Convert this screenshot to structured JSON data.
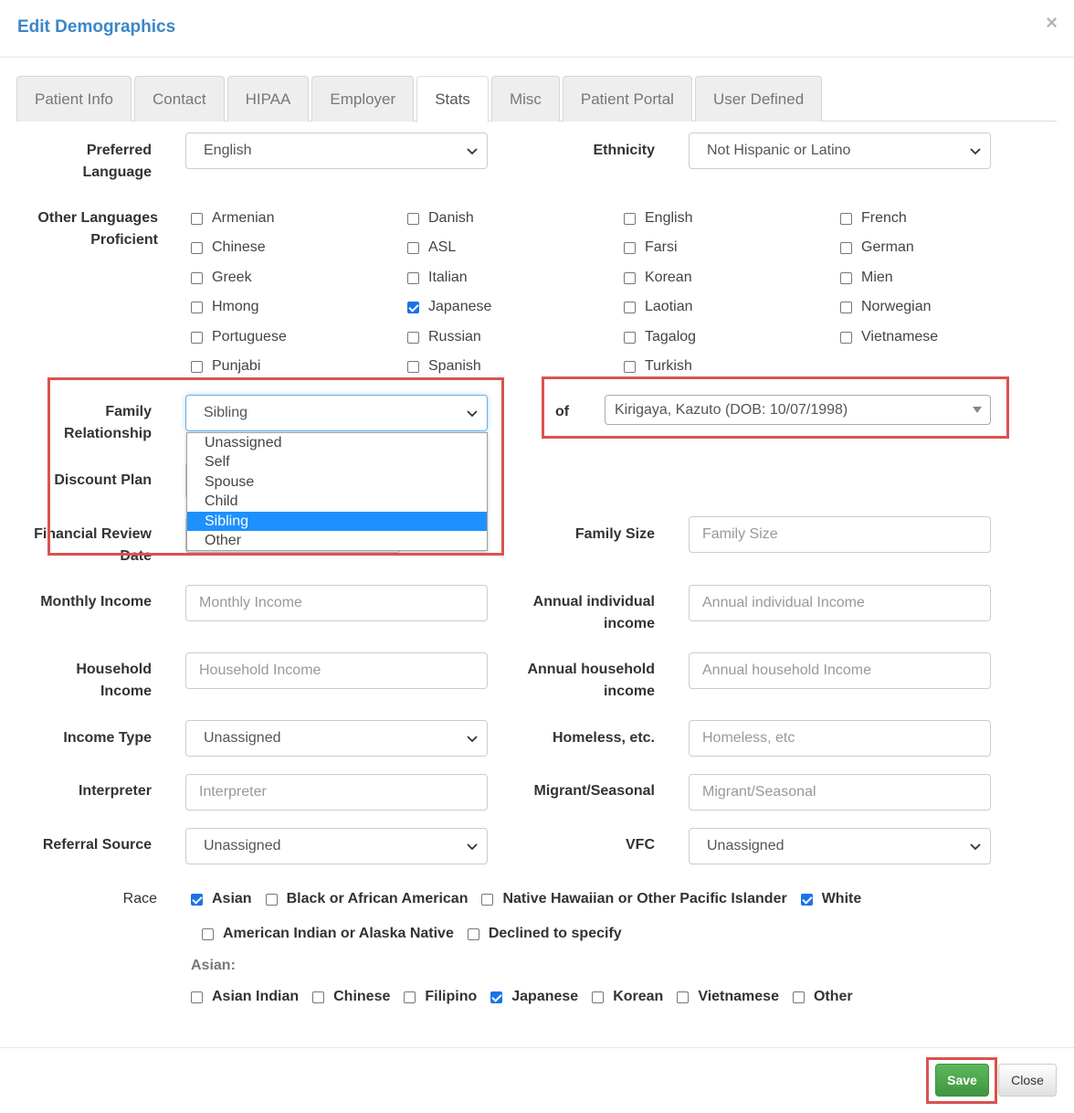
{
  "modal": {
    "title": "Edit Demographics",
    "close_icon": "close-x-icon"
  },
  "tabs": [
    {
      "label": "Patient Info",
      "active": false
    },
    {
      "label": "Contact",
      "active": false
    },
    {
      "label": "HIPAA",
      "active": false
    },
    {
      "label": "Employer",
      "active": false
    },
    {
      "label": "Stats",
      "active": true
    },
    {
      "label": "Misc",
      "active": false
    },
    {
      "label": "Patient Portal",
      "active": false
    },
    {
      "label": "User Defined",
      "active": false
    }
  ],
  "preferred_language": {
    "label_line1": "Preferred",
    "label_line2": "Language",
    "value": "English"
  },
  "ethnicity": {
    "label": "Ethnicity",
    "value": "Not Hispanic or Latino"
  },
  "other_languages": {
    "label_line1": "Other Languages",
    "label_line2": "Proficient",
    "columns": [
      [
        {
          "label": "Armenian",
          "checked": false
        },
        {
          "label": "Chinese",
          "checked": false
        },
        {
          "label": "Greek",
          "checked": false
        },
        {
          "label": "Hmong",
          "checked": false
        },
        {
          "label": "Portuguese",
          "checked": false
        },
        {
          "label": "Punjabi",
          "checked": false
        }
      ],
      [
        {
          "label": "Danish",
          "checked": false
        },
        {
          "label": "ASL",
          "checked": false
        },
        {
          "label": "Italian",
          "checked": false
        },
        {
          "label": "Japanese",
          "checked": true
        },
        {
          "label": "Russian",
          "checked": false
        },
        {
          "label": "Spanish",
          "checked": false
        }
      ],
      [
        {
          "label": "English",
          "checked": false
        },
        {
          "label": "Farsi",
          "checked": false
        },
        {
          "label": "Korean",
          "checked": false
        },
        {
          "label": "Laotian",
          "checked": false
        },
        {
          "label": "Tagalog",
          "checked": false
        },
        {
          "label": "Turkish",
          "checked": false
        }
      ],
      [
        {
          "label": "French",
          "checked": false
        },
        {
          "label": "German",
          "checked": false
        },
        {
          "label": "Mien",
          "checked": false
        },
        {
          "label": "Norwegian",
          "checked": false
        },
        {
          "label": "Vietnamese",
          "checked": false
        }
      ]
    ]
  },
  "family_relationship": {
    "label_line1": "Family",
    "label_line2": "Relationship",
    "value": "Sibling",
    "options": [
      "Unassigned",
      "Self",
      "Spouse",
      "Child",
      "Sibling",
      "Other"
    ],
    "selected_index": 4
  },
  "of": {
    "label": "of",
    "value": "Kirigaya, Kazuto (DOB: 10/07/1998)"
  },
  "discount_plan": {
    "label": "Discount Plan"
  },
  "financial_review_date": {
    "label_line1": "Financial Review",
    "label_line2": "Date"
  },
  "family_size": {
    "label": "Family Size",
    "placeholder": "Family Size"
  },
  "monthly_income": {
    "label": "Monthly Income",
    "placeholder": "Monthly Income"
  },
  "annual_individual_income": {
    "label_line1": "Annual individual",
    "label_line2": "income",
    "placeholder": "Annual individual Income"
  },
  "household_income": {
    "label_line1": "Household",
    "label_line2": "Income",
    "placeholder": "Household Income"
  },
  "annual_household_income": {
    "label_line1": "Annual household",
    "label_line2": "income",
    "placeholder": "Annual household Income"
  },
  "income_type": {
    "label": "Income Type",
    "value": "Unassigned"
  },
  "homeless": {
    "label": "Homeless, etc.",
    "placeholder": "Homeless, etc"
  },
  "interpreter": {
    "label": "Interpreter",
    "placeholder": "Interpreter"
  },
  "migrant_seasonal": {
    "label": "Migrant/Seasonal",
    "placeholder": "Migrant/Seasonal"
  },
  "referral_source": {
    "label": "Referral Source",
    "value": "Unassigned"
  },
  "vfc": {
    "label": "VFC",
    "value": "Unassigned"
  },
  "race": {
    "label": "Race",
    "row1": [
      {
        "label": "Asian",
        "checked": true
      },
      {
        "label": "Black or African American",
        "checked": false
      },
      {
        "label": "Native Hawaiian or Other Pacific Islander",
        "checked": false
      },
      {
        "label": "White",
        "checked": true
      }
    ],
    "row2": [
      {
        "label": "American Indian or Alaska Native",
        "checked": false
      },
      {
        "label": "Declined to specify",
        "checked": false
      }
    ],
    "asian_heading": "Asian:",
    "asian": [
      {
        "label": "Asian Indian",
        "checked": false
      },
      {
        "label": "Chinese",
        "checked": false
      },
      {
        "label": "Filipino",
        "checked": false
      },
      {
        "label": "Japanese",
        "checked": true
      },
      {
        "label": "Korean",
        "checked": false
      },
      {
        "label": "Vietnamese",
        "checked": false
      },
      {
        "label": "Other",
        "checked": false
      }
    ]
  },
  "footer": {
    "save_label": "Save",
    "close_label": "Close"
  },
  "colors": {
    "title": "#3b86c8",
    "highlight": "#d9534f",
    "save": "#4cae4c",
    "dropdown_selected": "#1e90ff",
    "checkbox_checked": "#1a73e8"
  }
}
